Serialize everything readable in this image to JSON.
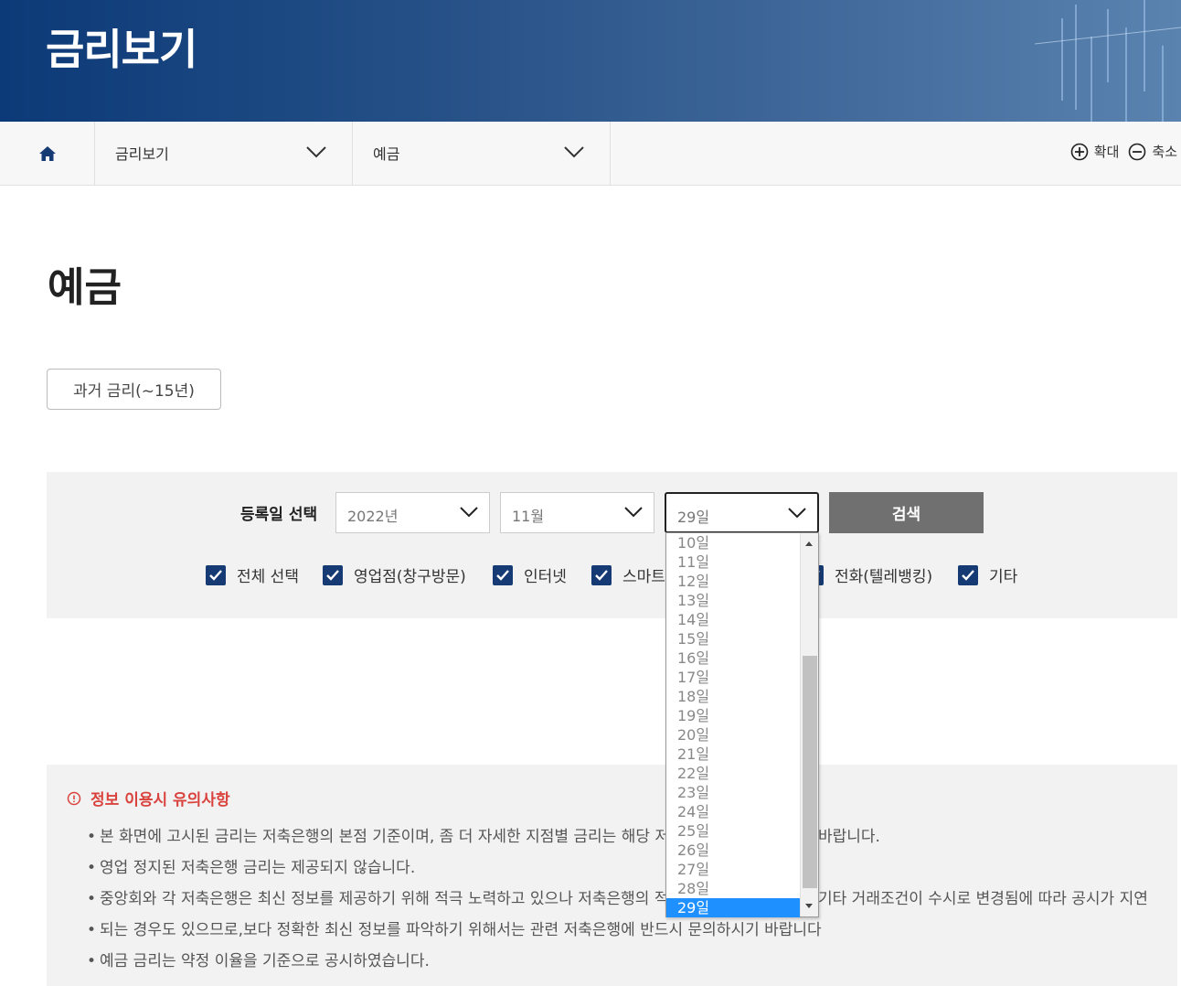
{
  "banner": {
    "title": "금리보기"
  },
  "nav": {
    "menu1": "금리보기",
    "menu2": "예금",
    "zoom_in": "확대",
    "zoom_out": "축소"
  },
  "page_title": "예금",
  "past_button": "과거 금리(~15년)",
  "search": {
    "label": "등록일 선택",
    "year": "2022년",
    "month": "11월",
    "day": "29일",
    "button": "검색"
  },
  "checkboxes": [
    {
      "label": "전체 선택",
      "checked": true
    },
    {
      "label": "영업점(창구방문)",
      "checked": true
    },
    {
      "label": "인터넷",
      "checked": true
    },
    {
      "label": "스마트",
      "checked": true
    },
    {
      "label": "전화(텔레뱅킹)",
      "checked": true
    },
    {
      "label": "기타",
      "checked": true
    }
  ],
  "day_options": [
    "10일",
    "11일",
    "12일",
    "13일",
    "14일",
    "15일",
    "16일",
    "17일",
    "18일",
    "19일",
    "20일",
    "21일",
    "22일",
    "23일",
    "24일",
    "25일",
    "26일",
    "27일",
    "28일",
    "29일"
  ],
  "notice": {
    "title": "정보 이용시 유의사항",
    "items": [
      "본 화면에 고시된 금리는 저축은행의 본점 기준이며, 좀 더 자세한 지점별 금리는 해당 저축",
      "영업 정지된 저축은행 금리는 제공되지 않습니다.",
      "중앙회와 각 저축은행은 최신 정보를 제공하기 위해 적극 노력하고 있으나 저축은행의 적금",
      "되는 경우도 있으므로,보다 정확한 최신 정보를 파악하기 위해서는 관련 저축은행에 반드시 문의하시기 바랍니다",
      "예금 금리는 약정 이율을 기준으로 공시하였습니다."
    ],
    "tail1": "바랍니다.",
    "tail3": "기타 거래조건이 수시로 변경됨에 따라 공시가 지연"
  },
  "colors": {
    "accent": "#163b74",
    "notice": "#d9423d",
    "selected": "#1e90ff"
  }
}
